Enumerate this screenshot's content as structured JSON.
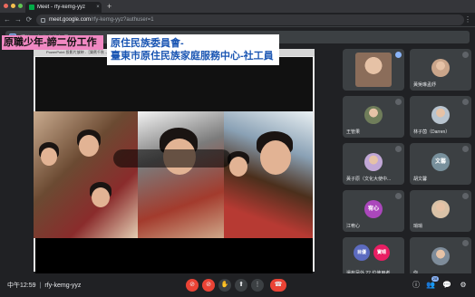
{
  "browser": {
    "tab_title": "Meet - rfy-kemg-yyz",
    "tab_close": "×",
    "new_tab": "+",
    "url_host": "meet.google.com",
    "url_path": "/rfy-kemg-yyz?authuser=1",
    "nav": {
      "back": "←",
      "forward": "→",
      "reload": "⟳",
      "menu": "⋮"
    },
    "dot_colors": [
      "#ed6a5e",
      "#f5bf4f",
      "#61c554"
    ]
  },
  "banner": {
    "text": "譚婷正在分享簡報畫面"
  },
  "presentation": {
    "window_title": "PowerPoint 投影片放映 -［樂賓千秋 -原住 賽部］- Microsoft PowerPoint",
    "left_title": "原職少年-諦二份工作",
    "right_title_line1": "原住民族委員會-",
    "right_title_line2": "臺東市原住民族家庭服務中心-社工員",
    "progress": 0
  },
  "participants": [
    {
      "name": "",
      "avatar": "video",
      "color": "#8b6d5a"
    },
    {
      "name": "黃吳琳孟妤",
      "avatar": "photo",
      "color": "#caa58a"
    },
    {
      "name": "王管果",
      "avatar": "photo",
      "color": "#6f7d5a"
    },
    {
      "name": "林子茵（Darren）",
      "avatar": "photo",
      "color": "#b8c4cf"
    },
    {
      "name": "黃子原（文化大使中...",
      "avatar": "photo",
      "color": "#c1a7d6"
    },
    {
      "name": "胡文馨",
      "avatar": "text",
      "label": "文馨",
      "color": "#78909c"
    },
    {
      "name": "江宥心",
      "avatar": "text",
      "label": "宥心",
      "color": "#ab47bc"
    },
    {
      "name": "琑琑",
      "avatar": "photo",
      "color": "#d9c2a7"
    },
    {
      "name": "還有另外 22 位使用者",
      "avatar": "group",
      "label1": "目優",
      "label2": "寶晴",
      "color": "#5c6bc0",
      "color2": "#e91e63"
    },
    {
      "name": "你",
      "avatar": "photo",
      "color": "#7e8c9a"
    }
  ],
  "bottom": {
    "time": "中午12:59",
    "separator": "|",
    "meeting_code": "rfy-kemg-yyz",
    "controls": {
      "mic": "⊘",
      "cam": "⊘",
      "raise": "✋",
      "present": "⬆",
      "more": "⋮",
      "end": "☎"
    },
    "right": {
      "info": "ⓘ",
      "people": "👥",
      "people_count": "28",
      "chat": "💬",
      "activities": "⚙"
    }
  }
}
